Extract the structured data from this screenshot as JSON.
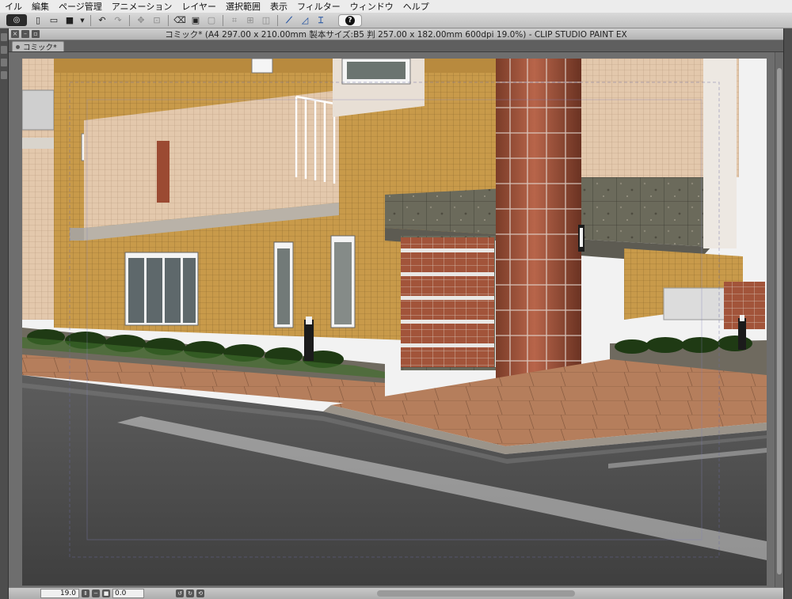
{
  "menu": {
    "items": [
      "イル",
      "編集",
      "ページ管理",
      "アニメーション",
      "レイヤー",
      "選択範囲",
      "表示",
      "フィルター",
      "ウィンドウ",
      "ヘルプ"
    ]
  },
  "toolbar": {
    "help_glyph": "?",
    "icons": [
      "new-icon",
      "open-icon",
      "save-icon",
      "undo-icon",
      "redo-icon",
      "transform-icon",
      "clear-icon",
      "fill-icon",
      "layer-icon",
      "ruler-icon",
      "snap-ruler-icon",
      "snap-grid-icon",
      "snap-special-ruler-icon"
    ]
  },
  "window": {
    "title": "コミック* (A4 297.00 x 210.00mm 製本サイズ:B5 判 257.00 x 182.00mm 600dpi 19.0%) - CLIP STUDIO PAINT EX",
    "tab_label": "コミック*"
  },
  "status": {
    "zoom": "19.0",
    "rotation": "0.0"
  },
  "colors": {
    "menubar": "#ececec",
    "toolbar": "#c9c9c9",
    "workspace": "#6e6e6e",
    "accent_blue": "#1d4fa0"
  }
}
